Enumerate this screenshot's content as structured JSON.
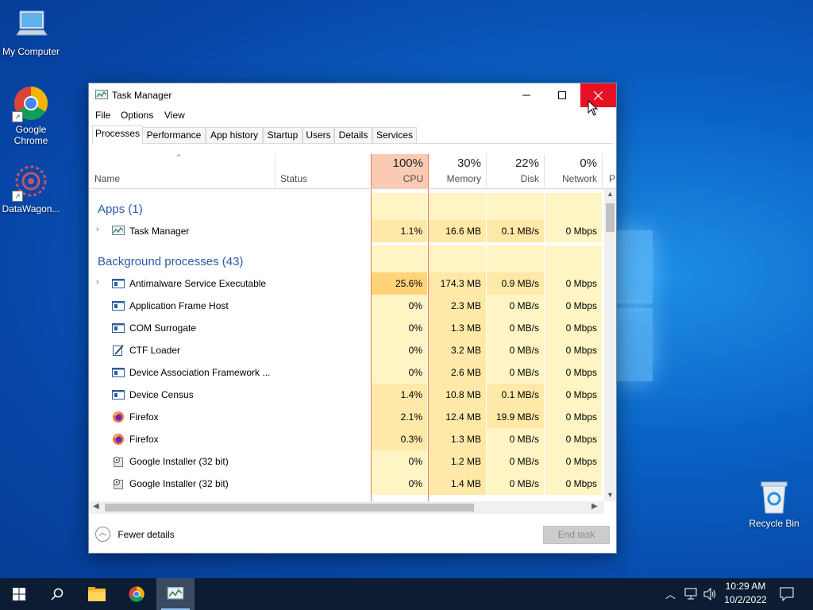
{
  "desktop": {
    "icons": [
      {
        "label": "My Computer"
      },
      {
        "label": "Google Chrome"
      },
      {
        "label": "DataWagon..."
      },
      {
        "label": "Recycle Bin"
      }
    ]
  },
  "window": {
    "title": "Task Manager",
    "menu": [
      "File",
      "Options",
      "View"
    ],
    "tabs": [
      "Processes",
      "Performance",
      "App history",
      "Startup",
      "Users",
      "Details",
      "Services"
    ],
    "active_tab": "Processes",
    "columns": {
      "name": "Name",
      "status": "Status",
      "cpu": {
        "pct": "100%",
        "label": "CPU"
      },
      "memory": {
        "pct": "30%",
        "label": "Memory"
      },
      "disk": {
        "pct": "22%",
        "label": "Disk"
      },
      "network": {
        "pct": "0%",
        "label": "Network"
      },
      "power_partial": "P"
    },
    "groups": {
      "apps": "Apps (1)",
      "background": "Background processes (43)"
    },
    "app_rows": [
      {
        "name": "Task Manager",
        "cpu": "1.1%",
        "memory": "16.6 MB",
        "disk": "0.1 MB/s",
        "network": "0 Mbps",
        "icon": "taskmanager-icon",
        "expandable": true
      }
    ],
    "bg_rows": [
      {
        "name": "Antimalware Service Executable",
        "cpu": "25.6%",
        "memory": "174.3 MB",
        "disk": "0.9 MB/s",
        "network": "0 Mbps",
        "icon": "service-icon",
        "expandable": true,
        "heat": "high"
      },
      {
        "name": "Application Frame Host",
        "cpu": "0%",
        "memory": "2.3 MB",
        "disk": "0 MB/s",
        "network": "0 Mbps",
        "icon": "service-icon",
        "expandable": false
      },
      {
        "name": "COM Surrogate",
        "cpu": "0%",
        "memory": "1.3 MB",
        "disk": "0 MB/s",
        "network": "0 Mbps",
        "icon": "service-icon",
        "expandable": false
      },
      {
        "name": "CTF Loader",
        "cpu": "0%",
        "memory": "3.2 MB",
        "disk": "0 MB/s",
        "network": "0 Mbps",
        "icon": "ctf-icon",
        "expandable": false
      },
      {
        "name": "Device Association Framework ...",
        "cpu": "0%",
        "memory": "2.6 MB",
        "disk": "0 MB/s",
        "network": "0 Mbps",
        "icon": "service-icon",
        "expandable": false
      },
      {
        "name": "Device Census",
        "cpu": "1.4%",
        "memory": "10.8 MB",
        "disk": "0.1 MB/s",
        "network": "0 Mbps",
        "icon": "service-icon",
        "expandable": false
      },
      {
        "name": "Firefox",
        "cpu": "2.1%",
        "memory": "12.4 MB",
        "disk": "19.9 MB/s",
        "network": "0 Mbps",
        "icon": "firefox-icon",
        "expandable": false
      },
      {
        "name": "Firefox",
        "cpu": "0.3%",
        "memory": "1.3 MB",
        "disk": "0 MB/s",
        "network": "0 Mbps",
        "icon": "firefox-icon",
        "expandable": false
      },
      {
        "name": "Google Installer (32 bit)",
        "cpu": "0%",
        "memory": "1.2 MB",
        "disk": "0 MB/s",
        "network": "0 Mbps",
        "icon": "installer-icon",
        "expandable": false
      },
      {
        "name": "Google Installer (32 bit)",
        "cpu": "0%",
        "memory": "1.4 MB",
        "disk": "0 MB/s",
        "network": "0 Mbps",
        "icon": "installer-icon",
        "expandable": false
      }
    ],
    "footer": {
      "fewer_details": "Fewer details",
      "end_task": "End task"
    }
  },
  "taskbar": {
    "time": "10:29 AM",
    "date": "10/2/2022"
  },
  "colors": {
    "cpu_header": "#fbcab2",
    "cell_light": "#fff4c4",
    "cell_mid": "#ffe9a8",
    "cell_high": "#ffd37a",
    "close_button": "#e81123",
    "group_text": "#2a5aa8"
  }
}
